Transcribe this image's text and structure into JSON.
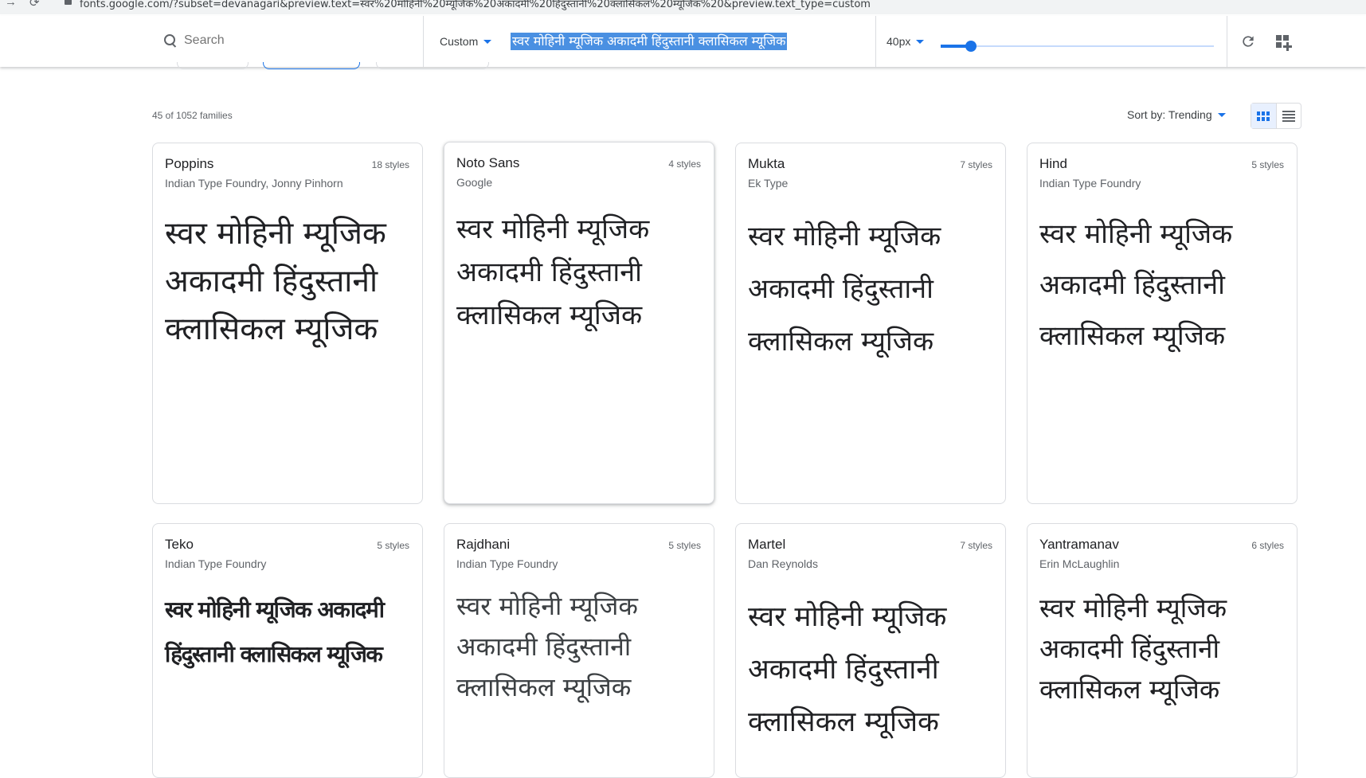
{
  "browser": {
    "url": "fonts.google.com/?subset=devanagari&preview.text=स्वर%20मोहिनी%20म्यूजिक%20अकादमी%20हिंदुस्तानी%20क्लासिकल%20म्यूजिक%20&preview.text_type=custom"
  },
  "toolbar": {
    "search_placeholder": "Search",
    "preview_type": "Custom",
    "preview_text": "स्वर मोहिनी म्यूजिक अकादमी हिंदुस्तानी क्लासिकल म्यूजिक",
    "font_size": "40px",
    "font_size_value": 40,
    "font_size_range": [
      8,
      300
    ]
  },
  "results": {
    "count": "45 of 1052 families",
    "sort": "Sort by: Trending"
  },
  "cards": [
    {
      "name": "Poppins",
      "styles": "18 styles",
      "designer": "Indian Type Foundry, Jonny Pinhorn"
    },
    {
      "name": "Noto Sans",
      "styles": "4 styles",
      "designer": "Google"
    },
    {
      "name": "Mukta",
      "styles": "7 styles",
      "designer": "Ek Type"
    },
    {
      "name": "Hind",
      "styles": "5 styles",
      "designer": "Indian Type Foundry"
    },
    {
      "name": "Teko",
      "styles": "5 styles",
      "designer": "Indian Type Foundry"
    },
    {
      "name": "Rajdhani",
      "styles": "5 styles",
      "designer": "Indian Type Foundry"
    },
    {
      "name": "Martel",
      "styles": "7 styles",
      "designer": "Dan Reynolds"
    },
    {
      "name": "Yantramanav",
      "styles": "6 styles",
      "designer": "Erin McLaughlin"
    }
  ],
  "colors": {
    "accent": "#1a73e8",
    "selection": "#4a90e2"
  }
}
